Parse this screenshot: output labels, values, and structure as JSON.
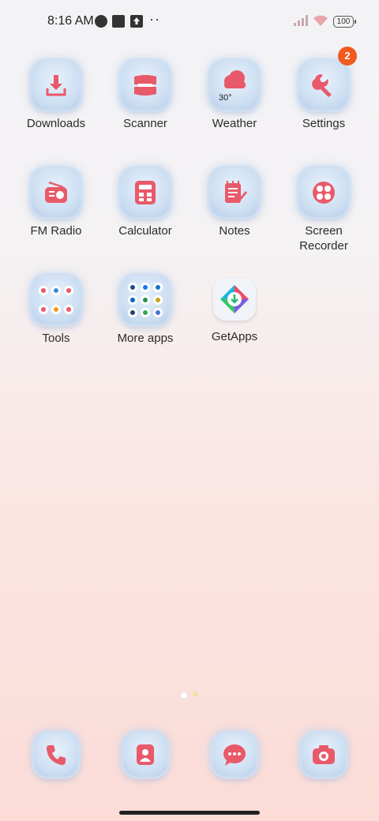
{
  "status_bar": {
    "time": "8:16 AM",
    "battery": "100",
    "notif_icons": [
      "circle-notification-icon",
      "square-notification-icon",
      "upload-notification-icon",
      "more-dots-icon"
    ],
    "dots": "··"
  },
  "apps": {
    "downloads": "Downloads",
    "scanner": "Scanner",
    "weather": "Weather",
    "weather_temp": "30°",
    "settings": "Settings",
    "settings_badge": "2",
    "fm_radio": "FM Radio",
    "calculator": "Calculator",
    "notes": "Notes",
    "screen_recorder_line1": "Screen",
    "screen_recorder_line2": "Recorder",
    "tools": "Tools",
    "more_apps": "More apps",
    "getapps": "GetApps"
  },
  "dock": [
    "phone-icon",
    "contacts-icon",
    "messages-icon",
    "camera-icon"
  ],
  "colors": {
    "accent_pink": "#e85a6a",
    "badge_orange": "#f25a1d",
    "icon_fur_blue": "#cfe0f3"
  }
}
